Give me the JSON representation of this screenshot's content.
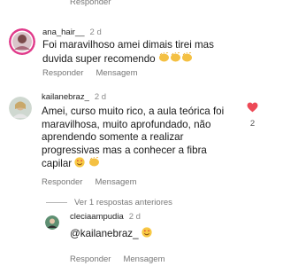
{
  "labels": {
    "respond": "Responder",
    "message": "Mensagem"
  },
  "comments": [
    {
      "username": "ana_hair__",
      "time": "2 d",
      "text": "Foi maravilhoso amei dimais tirei mas duvida super recomendo",
      "emojis": "clapping-hands x3"
    },
    {
      "username": "kailanebraz_",
      "time": "2 d",
      "text": "Amei, curso muito rico, a aula teórica foi maravilhosa, muito aprofundado, não aprendendo somente a realizar progressivas mas a conhecer a fibra capilar",
      "emojis": "smiling-face-with-heart-eyes, clapping-hands",
      "likes": "2"
    }
  ],
  "view_replies": "Ver 1 respostas anteriores",
  "reply": {
    "username": "cleciaampudia",
    "time": "2 d",
    "text": "@kailanebraz_",
    "emojis": "smiling-face-with-heart-eyes"
  },
  "colors": {
    "heart_liked": "#ed4956",
    "secondary_text": "#777777"
  }
}
